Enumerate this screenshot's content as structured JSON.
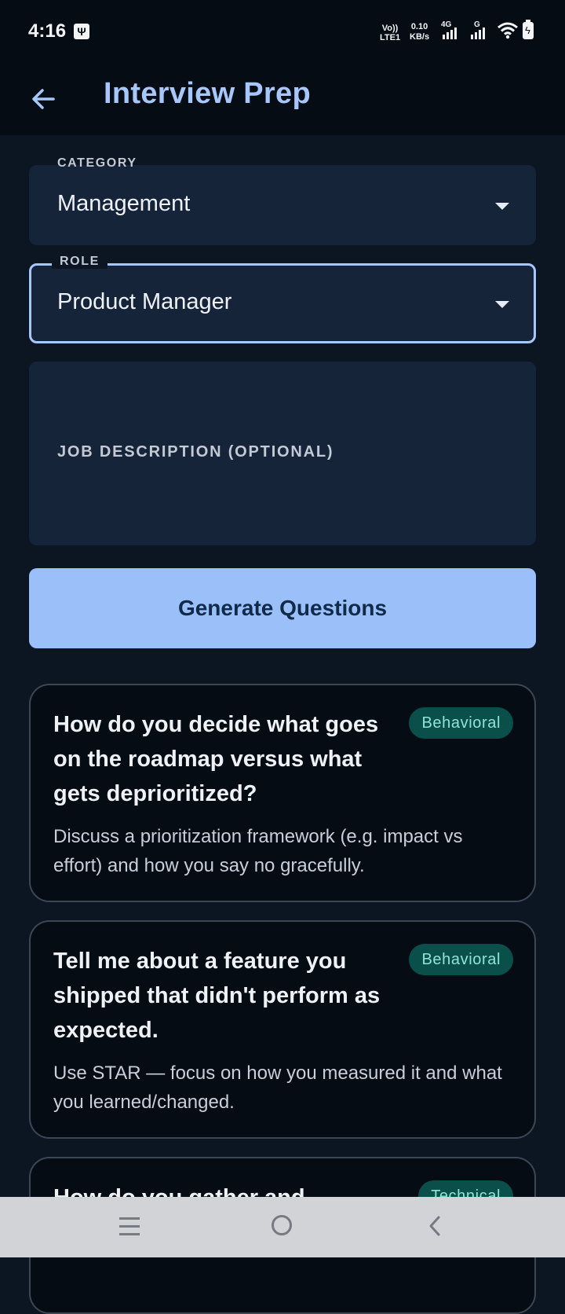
{
  "status_bar": {
    "time": "4:16",
    "volte_line1": "Vo))",
    "volte_line2": "LTE1",
    "speed_value": "0.10",
    "speed_unit": "KB/s",
    "network_1": "4G",
    "network_2": "G"
  },
  "app_bar": {
    "title": "Interview Prep"
  },
  "form": {
    "category": {
      "label": "CATEGORY",
      "value": "Management"
    },
    "role": {
      "label": "ROLE",
      "value": "Product Manager"
    },
    "job_description": {
      "label": "JOB DESCRIPTION (OPTIONAL)"
    },
    "generate_label": "Generate Questions"
  },
  "questions": [
    {
      "question": "How do you decide what goes on the roadmap versus what gets deprioritized?",
      "tip": "Discuss a prioritization framework (e.g. impact vs effort) and how you say no gracefully.",
      "badge": "Behavioral"
    },
    {
      "question": "Tell me about a feature you shipped that didn't perform as expected.",
      "tip": "Use STAR — focus on how you measured it and what you learned/changed.",
      "badge": "Behavioral"
    },
    {
      "question": "How do you gather and",
      "badge": "Technical"
    }
  ],
  "colors": {
    "accent": "#a7c7fa",
    "button": "#9bbff8",
    "badge_bg": "#0a4f4a",
    "badge_text": "#8fe3d7"
  }
}
